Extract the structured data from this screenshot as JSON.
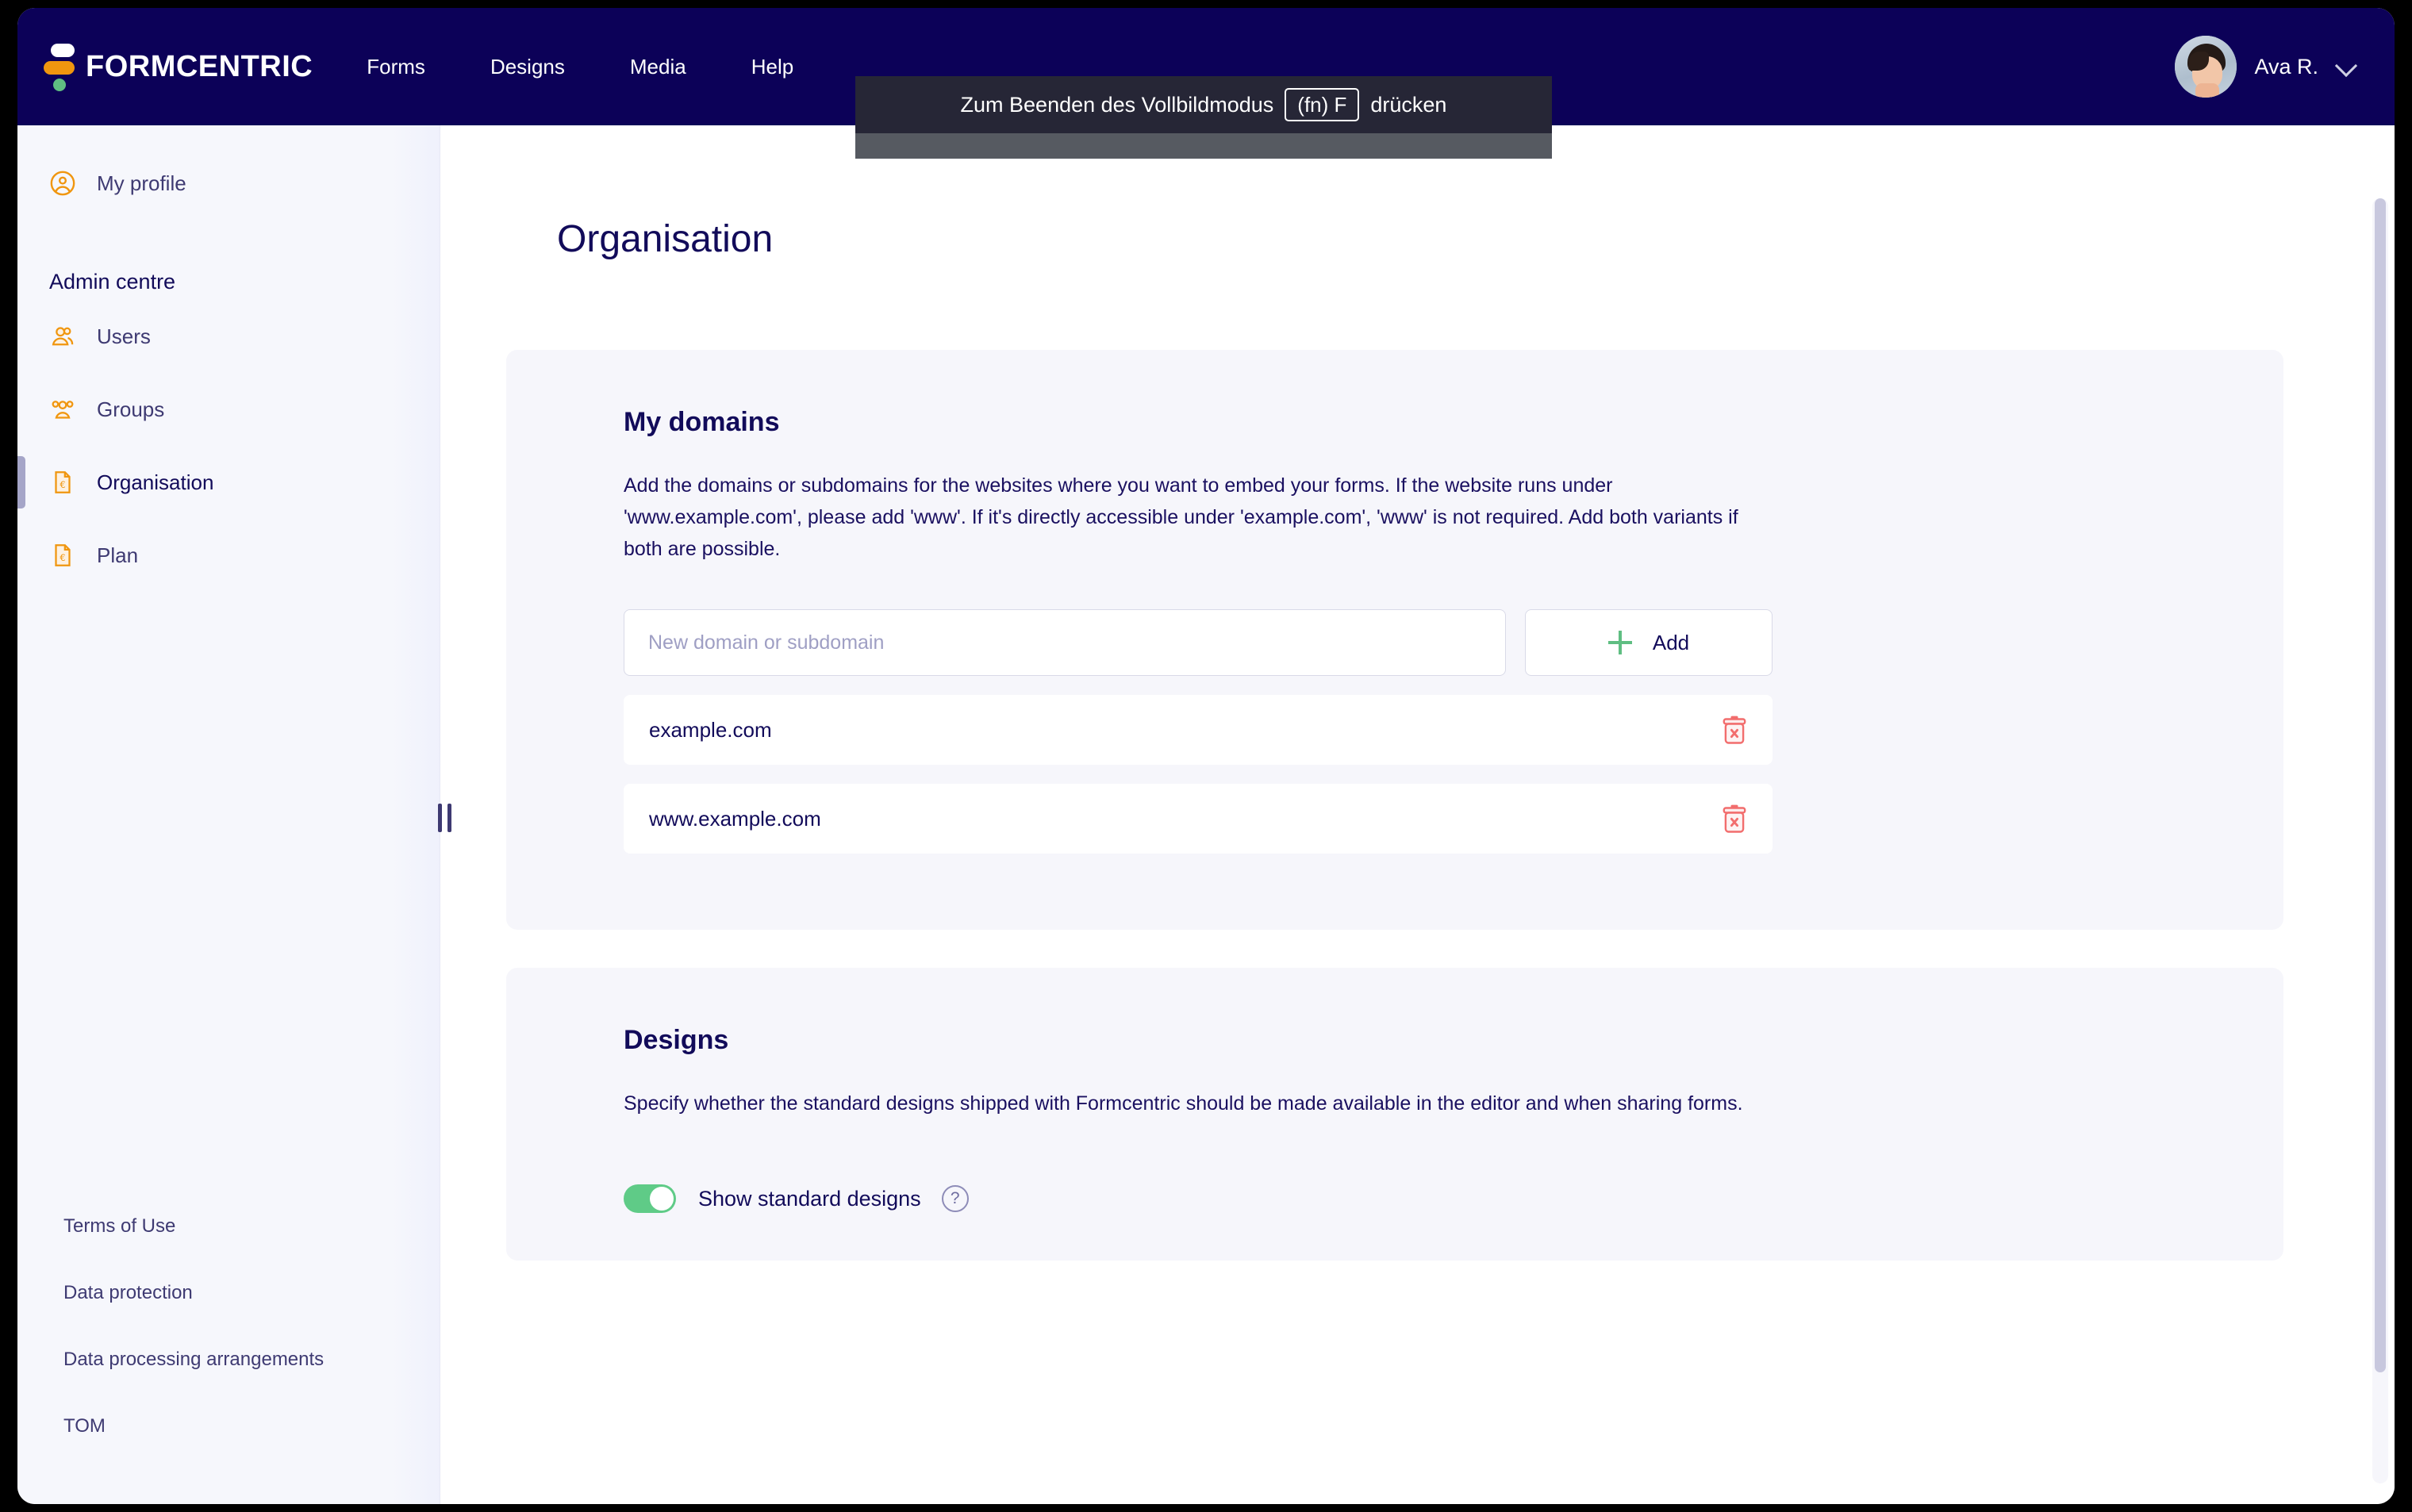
{
  "header": {
    "brand_name": "FORMCENTRIC",
    "nav_items": [
      {
        "label": "Forms"
      },
      {
        "label": "Designs"
      },
      {
        "label": "Media"
      },
      {
        "label": "Help"
      }
    ],
    "user": {
      "name": "Ava R.",
      "avatar_icon": "user-photo-avatar",
      "chevron_icon": "chevron-down-icon"
    },
    "colors": {
      "background": "#0C0158",
      "text": "#FFFFFF",
      "logo_orange": "#F0960F",
      "logo_green": "#5FBE82"
    }
  },
  "fullscreen_hint": {
    "text_before": "Zum Beenden des Vollbildmodus",
    "key": "(fn) F",
    "text_after": "drücken"
  },
  "sidebar": {
    "profile": {
      "label": "My profile",
      "icon": "user-circle-icon"
    },
    "section_title": "Admin centre",
    "items": [
      {
        "label": "Users",
        "icon": "users-icon",
        "active": false
      },
      {
        "label": "Groups",
        "icon": "group-icon",
        "active": false
      },
      {
        "label": "Organisation",
        "icon": "document-euro-icon",
        "active": true
      },
      {
        "label": "Plan",
        "icon": "document-euro-icon",
        "active": false
      }
    ],
    "footer_links": [
      {
        "label": "Terms of Use"
      },
      {
        "label": "Data protection"
      },
      {
        "label": "Data processing arrangements"
      },
      {
        "label": "TOM"
      }
    ],
    "resize_handle_icon": "drag-handle-icon"
  },
  "main": {
    "page_title": "Organisation",
    "domains_card": {
      "heading": "My domains",
      "description": "Add the domains or subdomains for the websites where you want to embed your forms. If the website runs under 'www.example.com', please add 'www'. If it's directly accessible under 'example.com', 'www' is not required. Add both variants if both are possible.",
      "input_placeholder": "New domain or subdomain",
      "input_value": "",
      "add_button_label": "Add",
      "add_button_icon": "plus-icon",
      "domains": [
        {
          "name": "example.com",
          "delete_icon": "trash-delete-icon"
        },
        {
          "name": "www.example.com",
          "delete_icon": "trash-delete-icon"
        }
      ]
    },
    "designs_card": {
      "heading": "Designs",
      "description": "Specify whether the standard designs shipped with Formcentric should be made available in the editor and when sharing forms.",
      "toggle_label": "Show standard designs",
      "toggle_state": "on",
      "help_icon": "question-mark-icon",
      "help_icon_label": "?"
    }
  },
  "colors": {
    "accent_orange": "#F0960F",
    "accent_green": "#5FCB87",
    "danger_red": "#F26D6D",
    "navy": "#120B5A",
    "card_bg": "#F6F6FB",
    "sidebar_bg": "#F6F7FC"
  }
}
